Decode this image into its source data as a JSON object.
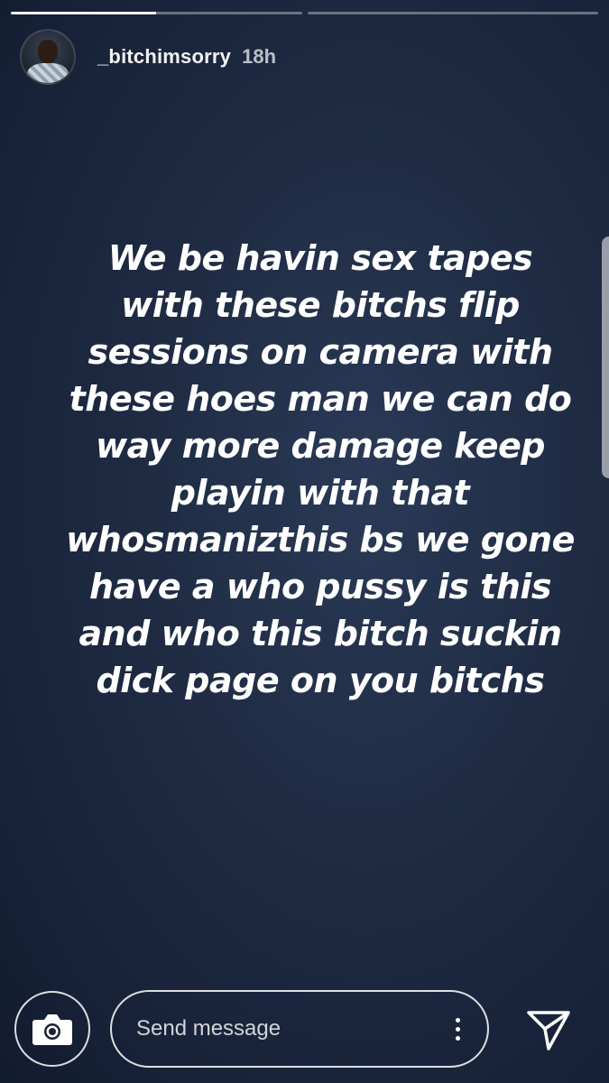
{
  "progress": {
    "segments": [
      {
        "filled": 0.5
      },
      {
        "filled": 0
      }
    ]
  },
  "header": {
    "username": "_bitchimsorry",
    "time": "18h"
  },
  "story": {
    "text": "We be havin sex tapes with these bitchs flip sessions on camera with these hoes man we can do way more damage keep playin with that whosmanizthis bs we gone have a who pussy is this and who this bitch suckin dick page on you bitchs",
    "text_color": "#ffffff",
    "background_color": "#1f2c44"
  },
  "bottom_bar": {
    "camera_icon": "camera-icon",
    "message_placeholder": "Send message",
    "more_icon": "more-vertical-icon",
    "send_icon": "send-icon"
  }
}
